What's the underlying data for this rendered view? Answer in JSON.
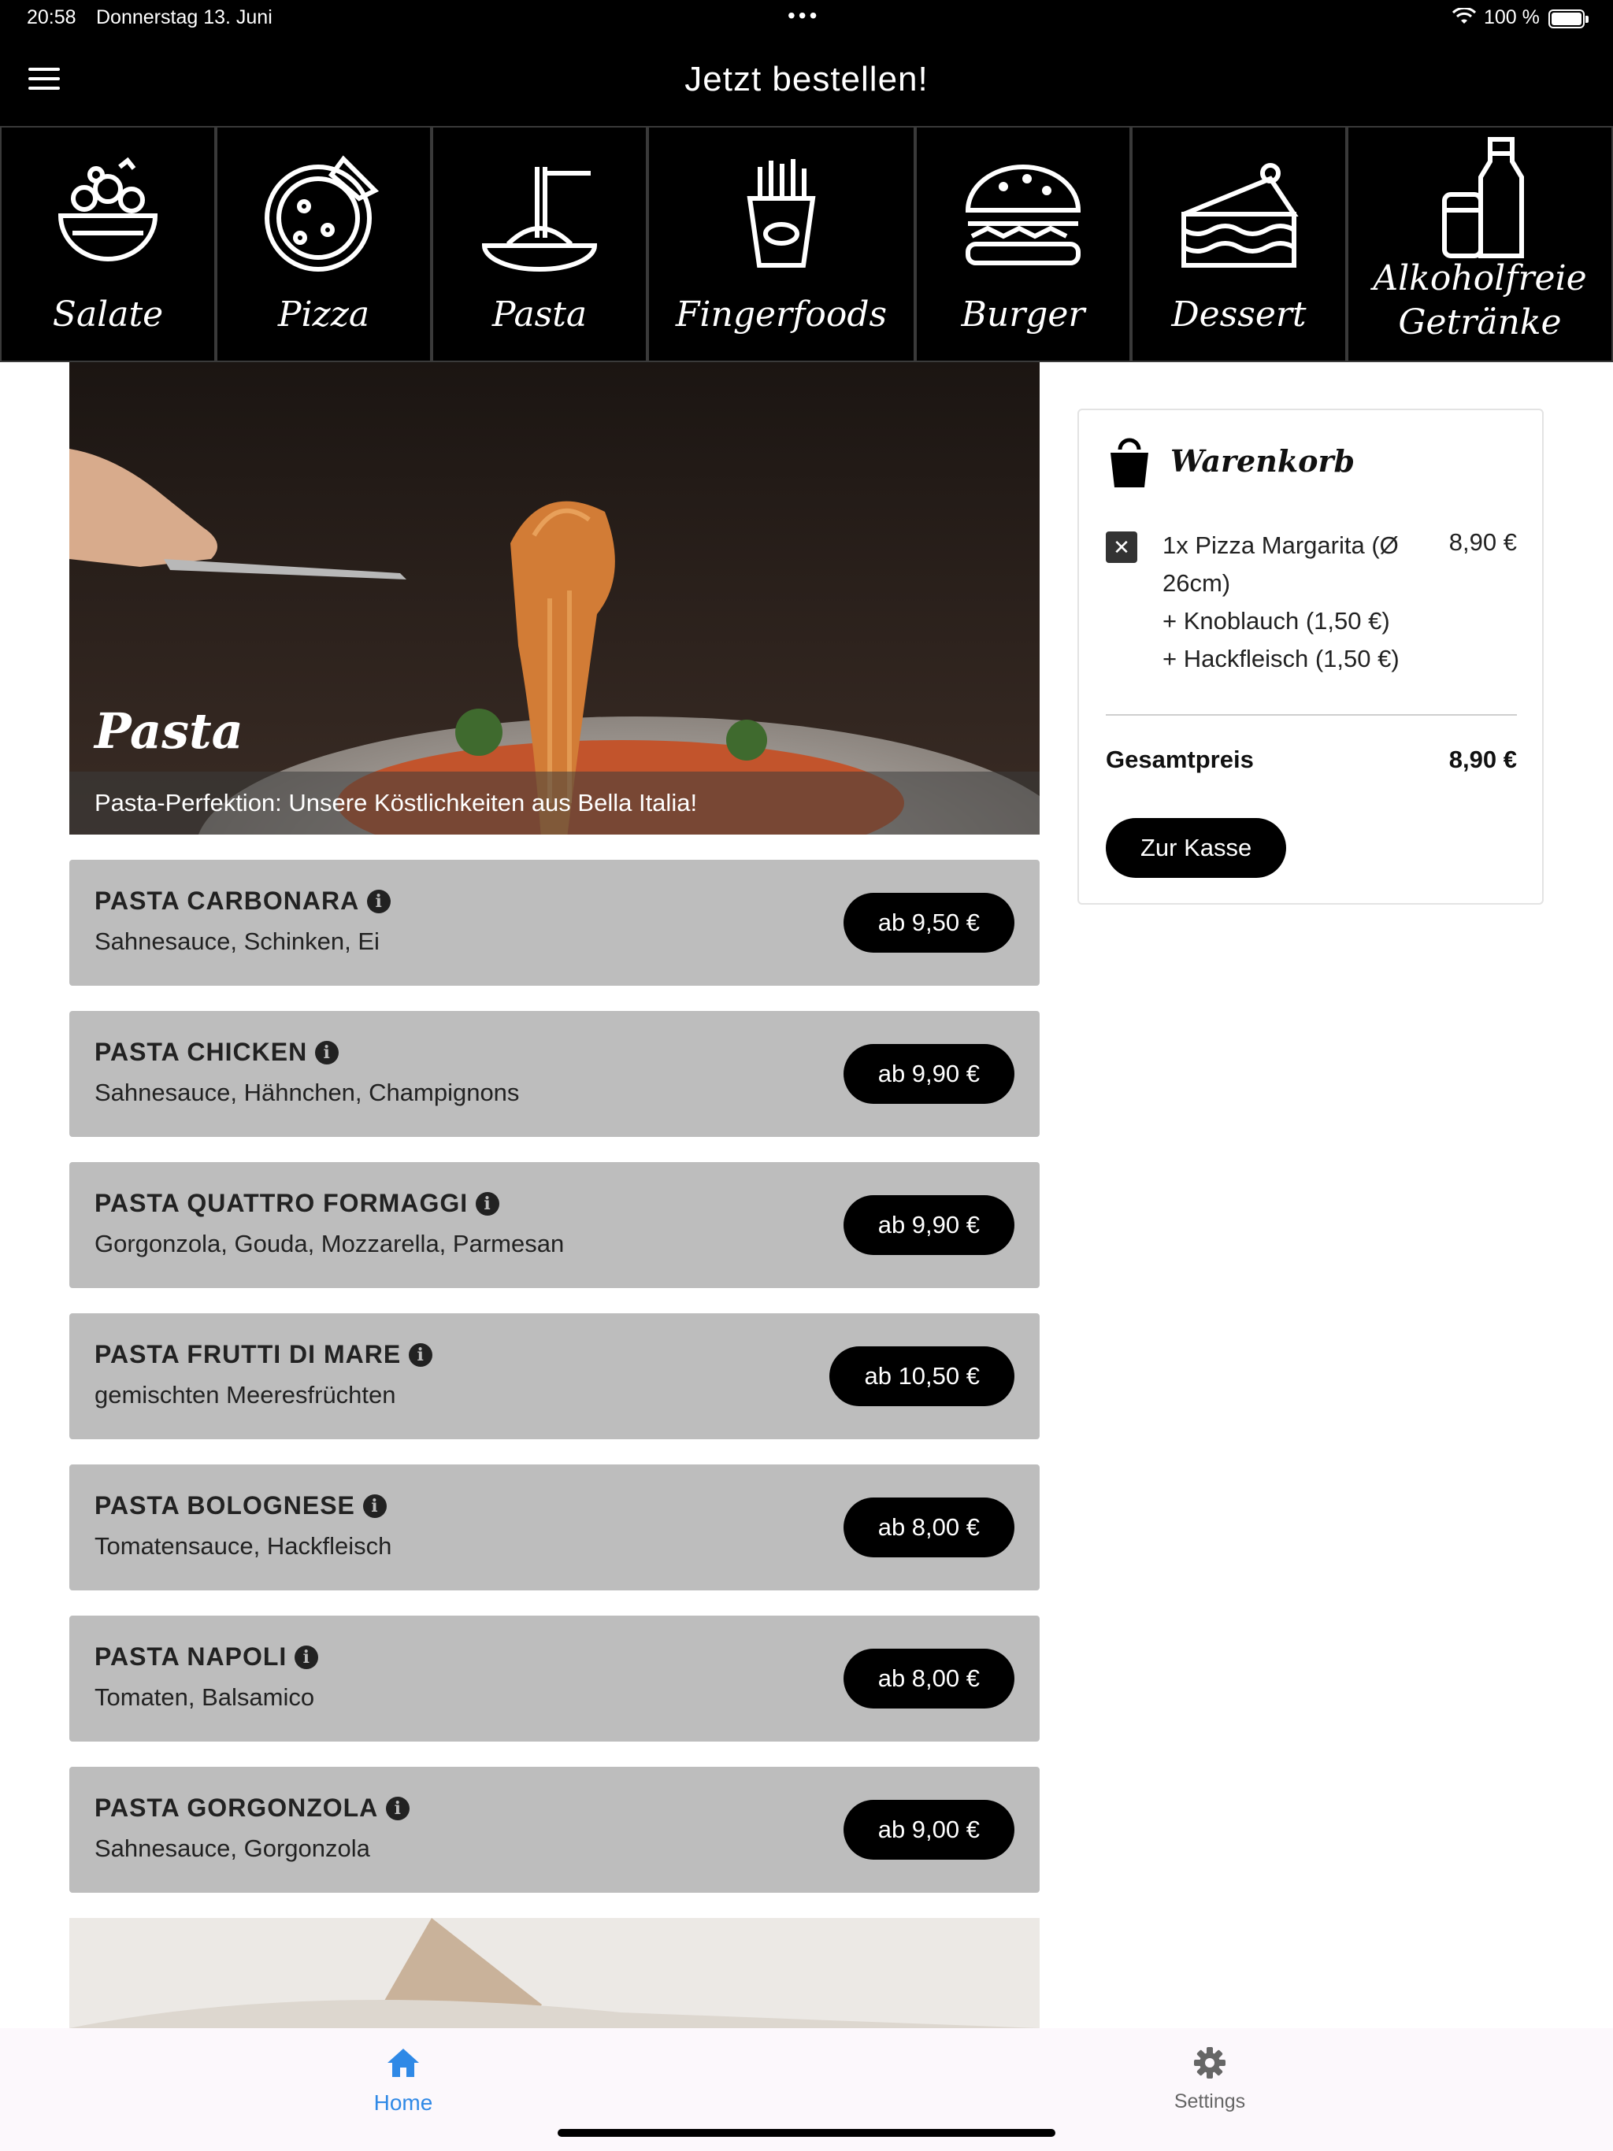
{
  "status_bar": {
    "time": "20:58",
    "date": "Donnerstag 13. Juni",
    "dots": "•••",
    "battery": "100 %",
    "battery_level": 1.0
  },
  "app_bar": {
    "title": "Jetzt bestellen!",
    "menu_icon": "hamburger-menu-icon"
  },
  "categories": [
    {
      "label": "Salate",
      "icon": "salad-bowl-icon"
    },
    {
      "label": "Pizza",
      "icon": "pizza-icon"
    },
    {
      "label": "Pasta",
      "icon": "pasta-icon"
    },
    {
      "label": "Fingerfoods",
      "icon": "fries-icon"
    },
    {
      "label": "Burger",
      "icon": "burger-icon"
    },
    {
      "label": "Dessert",
      "icon": "cake-icon"
    },
    {
      "label": "Alkoholfreie Getränke",
      "icon": "drinks-icon"
    }
  ],
  "hero": {
    "title": "Pasta",
    "caption": "Pasta-Perfektion: Unsere Köstlichkeiten aus Bella Italia!"
  },
  "menu_items": [
    {
      "name": "PASTA CARBONARA",
      "description": "Sahnesauce, Schinken, Ei",
      "price": "ab 9,50 €"
    },
    {
      "name": "PASTA CHICKEN",
      "description": "Sahnesauce, Hähnchen, Champignons",
      "price": "ab 9,90 €"
    },
    {
      "name": "PASTA QUATTRO FORMAGGI",
      "description": "Gorgonzola, Gouda, Mozzarella, Parmesan",
      "price": "ab 9,90 €"
    },
    {
      "name": "PASTA FRUTTI DI MARE",
      "description": "gemischten Meeresfrüchten",
      "price": "ab 10,50 €"
    },
    {
      "name": "PASTA BOLOGNESE",
      "description": "Tomatensauce, Hackfleisch",
      "price": "ab 8,00 €"
    },
    {
      "name": "PASTA NAPOLI",
      "description": "Tomaten, Balsamico",
      "price": "ab 8,00 €"
    },
    {
      "name": "PASTA GORGONZOLA",
      "description": "Sahnesauce, Gorgonzola",
      "price": "ab 9,00 €"
    }
  ],
  "cart": {
    "title": "Warenkorb",
    "icon": "shopping-bag-icon",
    "items": [
      {
        "line1": "1x Pizza Margarita (Ø 26cm)",
        "extra1": "+ Knoblauch (1,50 €)",
        "extra2": "+ Hackfleisch (1,50 €)",
        "price": "8,90 €"
      }
    ],
    "total_label": "Gesamtpreis",
    "total_value": "8,90 €",
    "checkout_label": "Zur Kasse"
  },
  "tabs": [
    {
      "label": "Home",
      "icon": "home-icon",
      "active": true
    },
    {
      "label": "Settings",
      "icon": "gear-icon",
      "active": false
    }
  ],
  "colors": {
    "active_tab": "#2f89e6",
    "item_bg": "#bdbdbd",
    "button_bg": "#000000"
  }
}
